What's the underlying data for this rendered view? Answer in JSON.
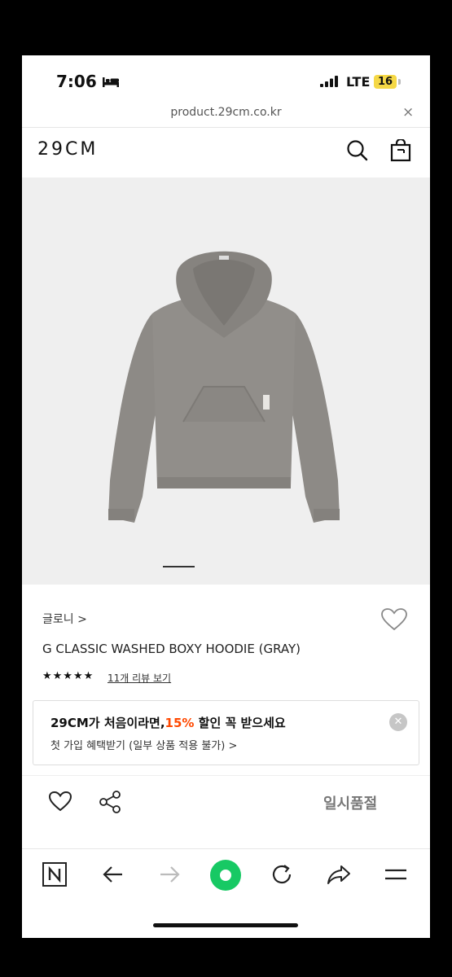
{
  "status_bar": {
    "time": "7:06",
    "network": "LTE",
    "battery": "16"
  },
  "browser": {
    "url": "product.29cm.co.kr",
    "close": "×"
  },
  "header": {
    "logo": "29CM"
  },
  "product": {
    "brand": "글로니 >",
    "title": "G CLASSIC WASHED BOXY HOODIE (GRAY)",
    "stars": "★★★★★",
    "rating": 5,
    "review_link": "11개 리뷰 보기"
  },
  "promo": {
    "main_before": "29CM가 처음이라면,",
    "main_pct": "15%",
    "main_after": " 할인 꼭 받으세요",
    "sub": "첫 가입 혜택받기 (일부 상품 적용 불가) >",
    "close": "✕"
  },
  "action_bar": {
    "status_label": "일시품절"
  },
  "colors": {
    "accent": "#ff4800",
    "toolbar_green": "#17c964",
    "image_bg": "#efefef"
  }
}
